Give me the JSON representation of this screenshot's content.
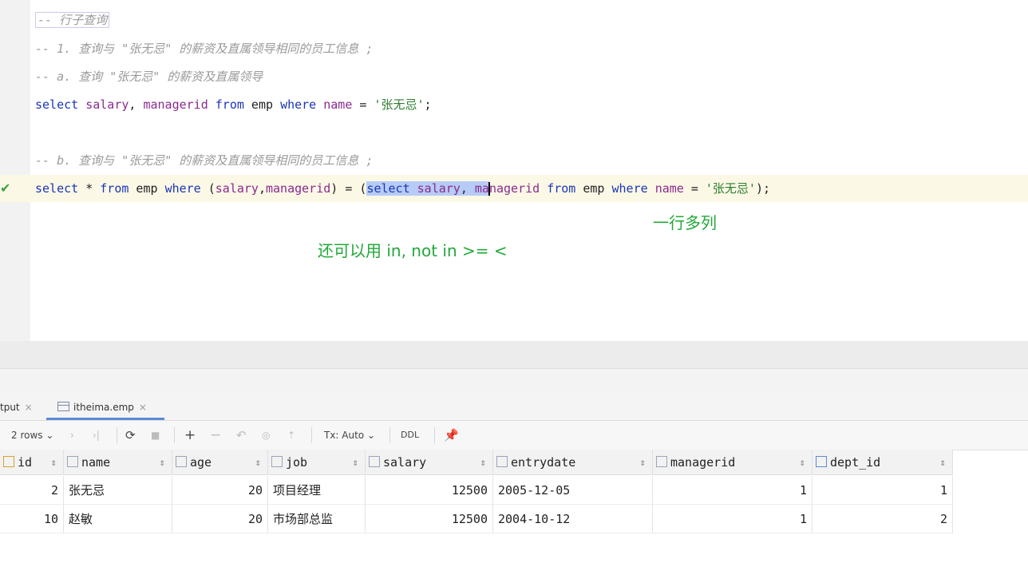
{
  "editor": {
    "lines": {
      "l1_comment": "-- 行子查询",
      "l2_comment": "-- 1. 查询与 \"张无忌\" 的薪资及直属领导相同的员工信息 ;",
      "l3_comment": "-- a. 查询 \"张无忌\" 的薪资及直属领导",
      "l5_comment": "-- b. 查询与 \"张无忌\" 的薪资及直属领导相同的员工信息 ;"
    },
    "gutter_check": "✔"
  },
  "annotations": {
    "one_row_multi_col": "一行多列",
    "also_usable": "还可以用 in, not in >= <"
  },
  "tabs": {
    "output": "tput",
    "emp": "itheima.emp"
  },
  "toolbar": {
    "rows": "2 rows",
    "tx": "Tx: Auto",
    "ddl": "DDL"
  },
  "table": {
    "columns": [
      "id",
      "name",
      "age",
      "job",
      "salary",
      "entrydate",
      "managerid",
      "dept_id"
    ],
    "rows": [
      [
        "2",
        "张无忌",
        "20",
        "项目经理",
        "12500",
        "2005-12-05",
        "1",
        "1"
      ],
      [
        "10",
        "赵敏",
        "20",
        "市场部总监",
        "12500",
        "2004-10-12",
        "1",
        "2"
      ]
    ]
  },
  "colors": {
    "keyword": "#1b36b8",
    "column": "#8a2a8e",
    "string": "#2f7d2f",
    "annotation": "#22a83a",
    "selection": "#b6cbf5"
  }
}
